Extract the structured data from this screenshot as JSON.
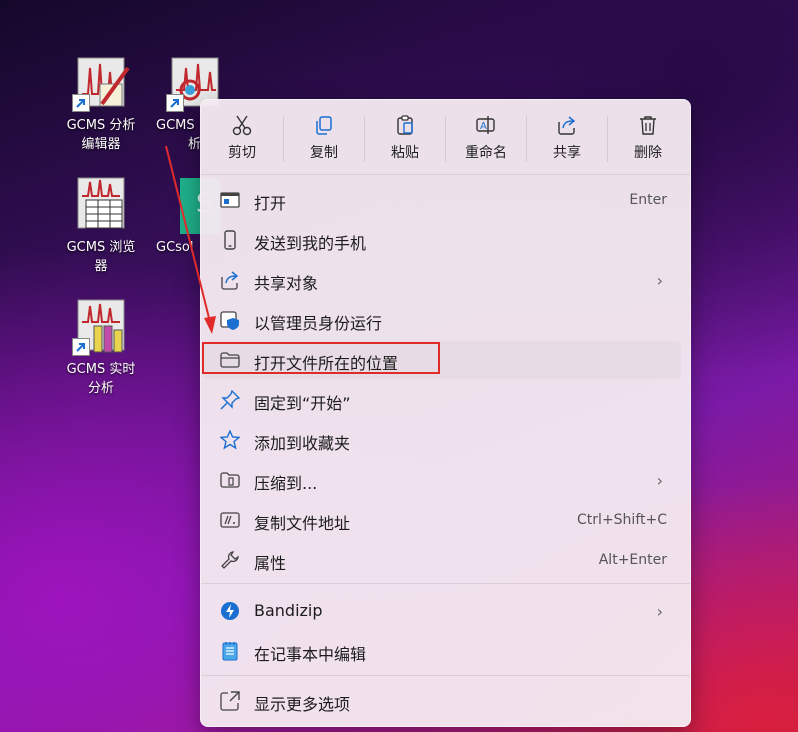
{
  "desktop": {
    "icons": [
      {
        "label_line1": "GCMS 分析",
        "label_line2": "编辑器"
      },
      {
        "label_line1": "GCMS",
        "label_line2": "析"
      },
      {
        "label_line1": "GCMS 浏览",
        "label_line2": "器"
      },
      {
        "label_line1": "GCsol",
        "label_line2": ""
      },
      {
        "label_line1": "GCMS 实时",
        "label_line2": "分析"
      }
    ]
  },
  "menu": {
    "toolbar": [
      {
        "label": "剪切",
        "icon": "cut-icon"
      },
      {
        "label": "复制",
        "icon": "copy-icon"
      },
      {
        "label": "粘贴",
        "icon": "paste-icon"
      },
      {
        "label": "重命名",
        "icon": "rename-icon"
      },
      {
        "label": "共享",
        "icon": "share-icon"
      },
      {
        "label": "删除",
        "icon": "trash-icon"
      }
    ],
    "items": [
      {
        "label": "打开",
        "shortcut": "Enter",
        "icon": "open-icon"
      },
      {
        "label": "发送到我的手机",
        "shortcut": "",
        "icon": "phone-icon"
      },
      {
        "label": "共享对象",
        "shortcut": "",
        "icon": "share-icon",
        "submenu": true
      },
      {
        "label": "以管理员身份运行",
        "shortcut": "",
        "icon": "shield-icon"
      },
      {
        "label": "打开文件所在的位置",
        "shortcut": "",
        "icon": "folder-icon",
        "highlighted": true
      },
      {
        "label": "固定到“开始”",
        "shortcut": "",
        "icon": "pin-icon"
      },
      {
        "label": "添加到收藏夹",
        "shortcut": "",
        "icon": "star-icon"
      },
      {
        "label": "压缩到...",
        "shortcut": "",
        "icon": "zip-icon",
        "submenu": true
      },
      {
        "label": "复制文件地址",
        "shortcut": "Ctrl+Shift+C",
        "icon": "path-icon"
      },
      {
        "label": "属性",
        "shortcut": "Alt+Enter",
        "icon": "wrench-icon"
      },
      {
        "label": "Bandizip",
        "shortcut": "",
        "icon": "bandizip-icon",
        "submenu": true
      },
      {
        "label": "在记事本中编辑",
        "shortcut": "",
        "icon": "notepad-icon"
      },
      {
        "label": "显示更多选项",
        "shortcut": "",
        "icon": "more-options-icon"
      }
    ],
    "submenu_glyph": "›"
  },
  "colors": {
    "highlight_box": "#e02b2b",
    "annotation_arrow": "#e02b2b",
    "accent": "#1a6fd1"
  }
}
